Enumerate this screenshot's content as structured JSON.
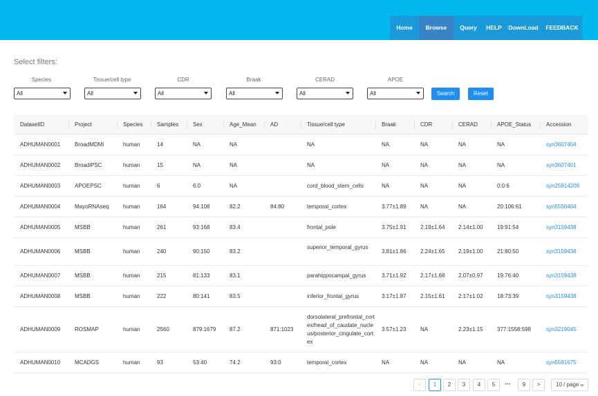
{
  "nav": [
    {
      "label": "Home",
      "active": false
    },
    {
      "label": "Browse",
      "active": true
    },
    {
      "label": "Query",
      "active": false
    },
    {
      "label": "HELP",
      "active": false
    },
    {
      "label": "DownLoad",
      "active": false
    },
    {
      "label": "FEEDBACK",
      "active": false
    }
  ],
  "filters": {
    "title": "Select filters:",
    "fields": [
      {
        "label": "Species",
        "value": "All"
      },
      {
        "label": "Tissue/cell type",
        "value": "All"
      },
      {
        "label": "CDR",
        "value": "All"
      },
      {
        "label": "Braak",
        "value": "All"
      },
      {
        "label": "CERAD",
        "value": "All"
      },
      {
        "label": "APOE",
        "value": "All"
      }
    ],
    "search_label": "Search",
    "reset_label": "Reset"
  },
  "table": {
    "headers": [
      "DatasetID",
      "Project",
      "Species",
      "Samples",
      "Sex",
      "Age_Mean",
      "AD",
      "Tissue/cell type",
      "Braak",
      "CDR",
      "CERAD",
      "APOE_Status",
      "Accession"
    ],
    "rows": [
      [
        "ADHUMAN0001",
        "BroadMDMi",
        "human",
        "14",
        "NA",
        "NA",
        "",
        "NA",
        "NA",
        "NA",
        "NA",
        "NA",
        "syn3607404"
      ],
      [
        "ADHUMAN0002",
        "BroadiPSC",
        "human",
        "15",
        "NA",
        "NA",
        "",
        "NA",
        "NA",
        "NA",
        "NA",
        "NA",
        "syn3607401"
      ],
      [
        "ADHUMAN0003",
        "APOEPSC",
        "human",
        "6",
        "6:0",
        "NA",
        "",
        "cord_blood_stem_cells",
        "NA",
        "NA",
        "NA",
        "0:0:6",
        "syn25914209"
      ],
      [
        "ADHUMAN0004",
        "MayoRNAseq",
        "human",
        "164",
        "94:108",
        "82.2",
        "84:80",
        "temporal_cortex",
        "3.77±1.89",
        "NA",
        "NA",
        "20:106:61",
        "syn5550404"
      ],
      [
        "ADHUMAN0005",
        "MSBB",
        "human",
        "261",
        "93:168",
        "83.4",
        "",
        "frontal_pole",
        "3.75±1.91",
        "2.19±1.64",
        "2.14±1.00",
        "19:91:54",
        "syn3159438"
      ],
      [
        "ADHUMAN0006",
        "MSBB",
        "human",
        "240",
        "90:150",
        "83.2",
        "",
        "superior_temporal_gyrus",
        "3.81±1.86",
        "2.24±1.65",
        "2.19±1.00",
        "21:80:50",
        "syn3159438"
      ],
      [
        "ADHUMAN0007",
        "MSBB",
        "human",
        "215",
        "81:133",
        "83.1",
        "",
        "parahippocampal_gyrus",
        "3.71±1.92",
        "2.17±1.68",
        "2.07±0.97",
        "19:76:40",
        "syn3159438"
      ],
      [
        "ADHUMAN0008",
        "MSBB",
        "human",
        "222",
        "80:141",
        "83.5",
        "",
        "inferior_frontal_gyrus",
        "3.17±1.87",
        "2.15±1.61",
        "2.17±1.02",
        "18:73:39",
        "syn3159438"
      ],
      [
        "ADHUMAN0009",
        "ROSMAP",
        "human",
        "2560",
        "879:1679",
        "87.2",
        "871:1023",
        "dorsolateral_prefrontal_cortex/head_of_caudate_nucleus/posterior_cingulate_cortex",
        "3.57±1.23",
        "NA",
        "2.23±1.15",
        "377:1558:598",
        "syn3219045"
      ],
      [
        "ADHUMAN0010",
        "MCADGS",
        "human",
        "93",
        "53:40",
        "74.2",
        "93:0",
        "temporal_cortex",
        "NA",
        "NA",
        "NA",
        "NA",
        "syn5591675"
      ]
    ]
  },
  "pagination": {
    "prev": "<",
    "pages": [
      "1",
      "2",
      "3",
      "4",
      "5"
    ],
    "ellipsis": "•••",
    "last": "9",
    "next": ">",
    "current": "1",
    "page_size": "10 / page"
  },
  "colors": {
    "header_bg": "#00b8ec",
    "nav_bg": "#1a9ad8",
    "nav_active": "#3883c6",
    "accent": "#1e8ff0"
  }
}
